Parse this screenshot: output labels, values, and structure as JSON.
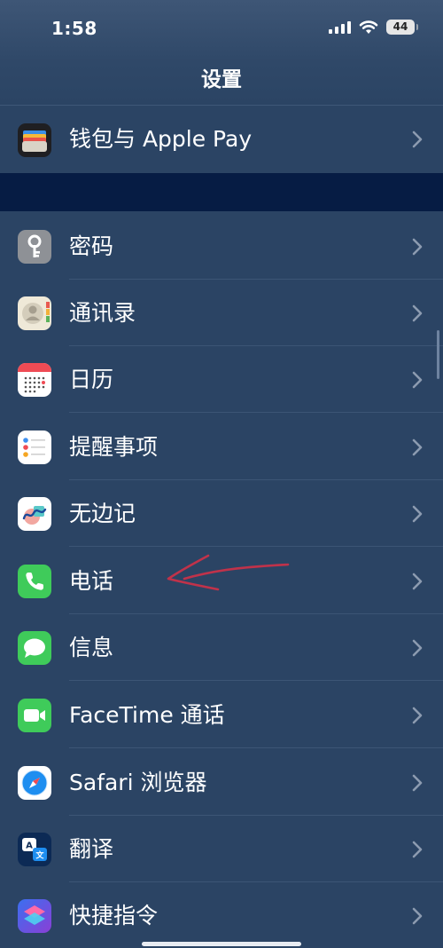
{
  "status_bar": {
    "time": "1:58",
    "battery_level": "44"
  },
  "header": {
    "title": "设置"
  },
  "top_group": {
    "items": [
      {
        "label": "钱包与 Apple Pay",
        "icon": "wallet-icon"
      }
    ]
  },
  "main_group": {
    "items": [
      {
        "label": "密码",
        "icon": "key-icon"
      },
      {
        "label": "通讯录",
        "icon": "contacts-icon"
      },
      {
        "label": "日历",
        "icon": "calendar-icon"
      },
      {
        "label": "提醒事项",
        "icon": "reminders-icon"
      },
      {
        "label": "无边记",
        "icon": "freeform-icon"
      },
      {
        "label": "电话",
        "icon": "phone-icon"
      },
      {
        "label": "信息",
        "icon": "messages-icon"
      },
      {
        "label": "FaceTime 通话",
        "icon": "facetime-icon"
      },
      {
        "label": "Safari 浏览器",
        "icon": "safari-icon"
      },
      {
        "label": "翻译",
        "icon": "translate-icon"
      },
      {
        "label": "快捷指令",
        "icon": "shortcuts-icon"
      }
    ]
  },
  "colors": {
    "background": "#243a5a",
    "row_background": "#2b4464",
    "separator_band": "#061c44",
    "annotation": "#c0324a"
  }
}
